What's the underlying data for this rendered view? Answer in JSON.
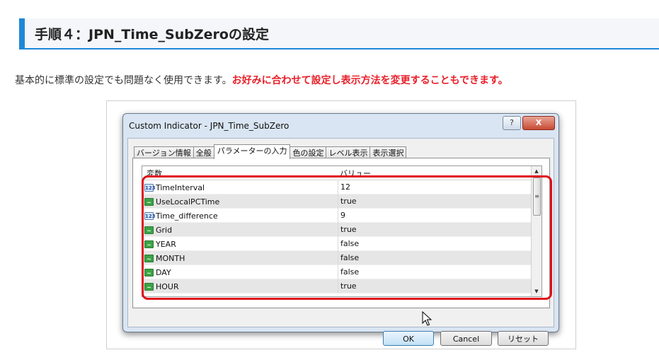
{
  "heading": "手順４：JPN_Time_SubZeroの設定",
  "intro": {
    "plain": "基本的に標準の設定でも問題なく使用できます。",
    "emphasis": "お好みに合わせて設定し表示方法を変更することもできます。"
  },
  "dialog": {
    "title": "Custom Indicator - JPN_Time_SubZero",
    "help_label": "?",
    "close_label": "X",
    "tabs": [
      "バージョン情報",
      "全般",
      "パラメーターの入力",
      "色の設定",
      "レベル表示",
      "表示選択"
    ],
    "active_tab": "パラメーターの入力",
    "columns": {
      "variable": "変数",
      "value": "バリュー"
    },
    "rows": [
      {
        "type": "num",
        "icon": "123",
        "name": "TimeInterval",
        "value": "12"
      },
      {
        "type": "bool",
        "icon": "boolean-icon",
        "name": "UseLocalPCTime",
        "value": "true"
      },
      {
        "type": "num",
        "icon": "123",
        "name": "Time_difference",
        "value": "9"
      },
      {
        "type": "bool",
        "icon": "boolean-icon",
        "name": "Grid",
        "value": "true"
      },
      {
        "type": "bool",
        "icon": "boolean-icon",
        "name": "YEAR",
        "value": "false"
      },
      {
        "type": "bool",
        "icon": "boolean-icon",
        "name": "MONTH",
        "value": "false"
      },
      {
        "type": "bool",
        "icon": "boolean-icon",
        "name": "DAY",
        "value": "false"
      },
      {
        "type": "bool",
        "icon": "boolean-icon",
        "name": "HOUR",
        "value": "true"
      }
    ],
    "buttons": {
      "ok": "OK",
      "cancel": "Cancel",
      "reset": "リセット"
    }
  },
  "colors": {
    "accent_blue": "#1e88d8",
    "emphasis_red": "#e8202a",
    "highlight_red": "#e0101a"
  }
}
